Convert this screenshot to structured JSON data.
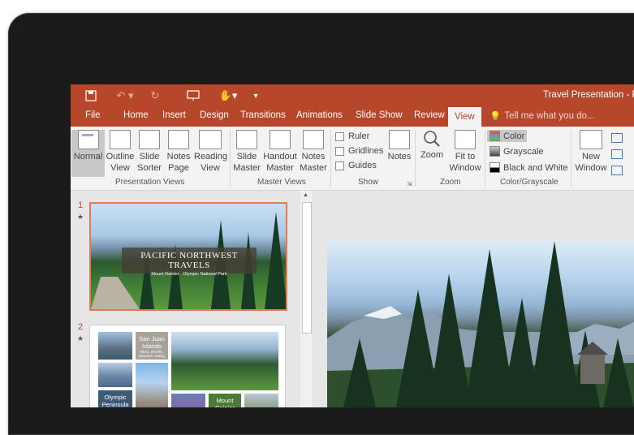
{
  "window": {
    "title": "Travel Presentation - P"
  },
  "tabs": [
    "File",
    "Home",
    "Insert",
    "Design",
    "Transitions",
    "Animations",
    "Slide Show",
    "Review",
    "View"
  ],
  "active_tab": "View",
  "tell_me": "Tell me what you do...",
  "ribbon": {
    "presentation_views": {
      "label": "Presentation Views",
      "normal": "Normal",
      "outline": [
        "Outline",
        "View"
      ],
      "sorter": [
        "Slide",
        "Sorter"
      ],
      "notes_page": [
        "Notes",
        "Page"
      ],
      "reading": [
        "Reading",
        "View"
      ]
    },
    "master_views": {
      "label": "Master Views",
      "slide": [
        "Slide",
        "Master"
      ],
      "handout": [
        "Handout",
        "Master"
      ],
      "notes": [
        "Notes",
        "Master"
      ]
    },
    "show": {
      "label": "Show",
      "ruler": "Ruler",
      "gridlines": "Gridlines",
      "guides": "Guides",
      "notes": "Notes"
    },
    "zoom": {
      "label": "Zoom",
      "zoom": "Zoom",
      "fit": [
        "Fit to",
        "Window"
      ]
    },
    "color": {
      "label": "Color/Grayscale",
      "color": "Color",
      "grayscale": "Grayscale",
      "bw": "Black and White"
    },
    "window": {
      "new": [
        "New",
        "Window"
      ]
    }
  },
  "slides": [
    {
      "number": "1",
      "title": "PACIFIC NORTHWEST TRAVELS",
      "subtitle": "Mount Rainier  .  Olympic National Park"
    },
    {
      "number": "2",
      "label_a": "San Juan Islands",
      "label_a_sub": "hikes, sea life, beaches, eating",
      "label_b": "Olympic Peninsula",
      "label_c": "Mount Rainier"
    }
  ],
  "colors": {
    "accent": "#b7472a",
    "ribbon": "#f3f3f3"
  }
}
